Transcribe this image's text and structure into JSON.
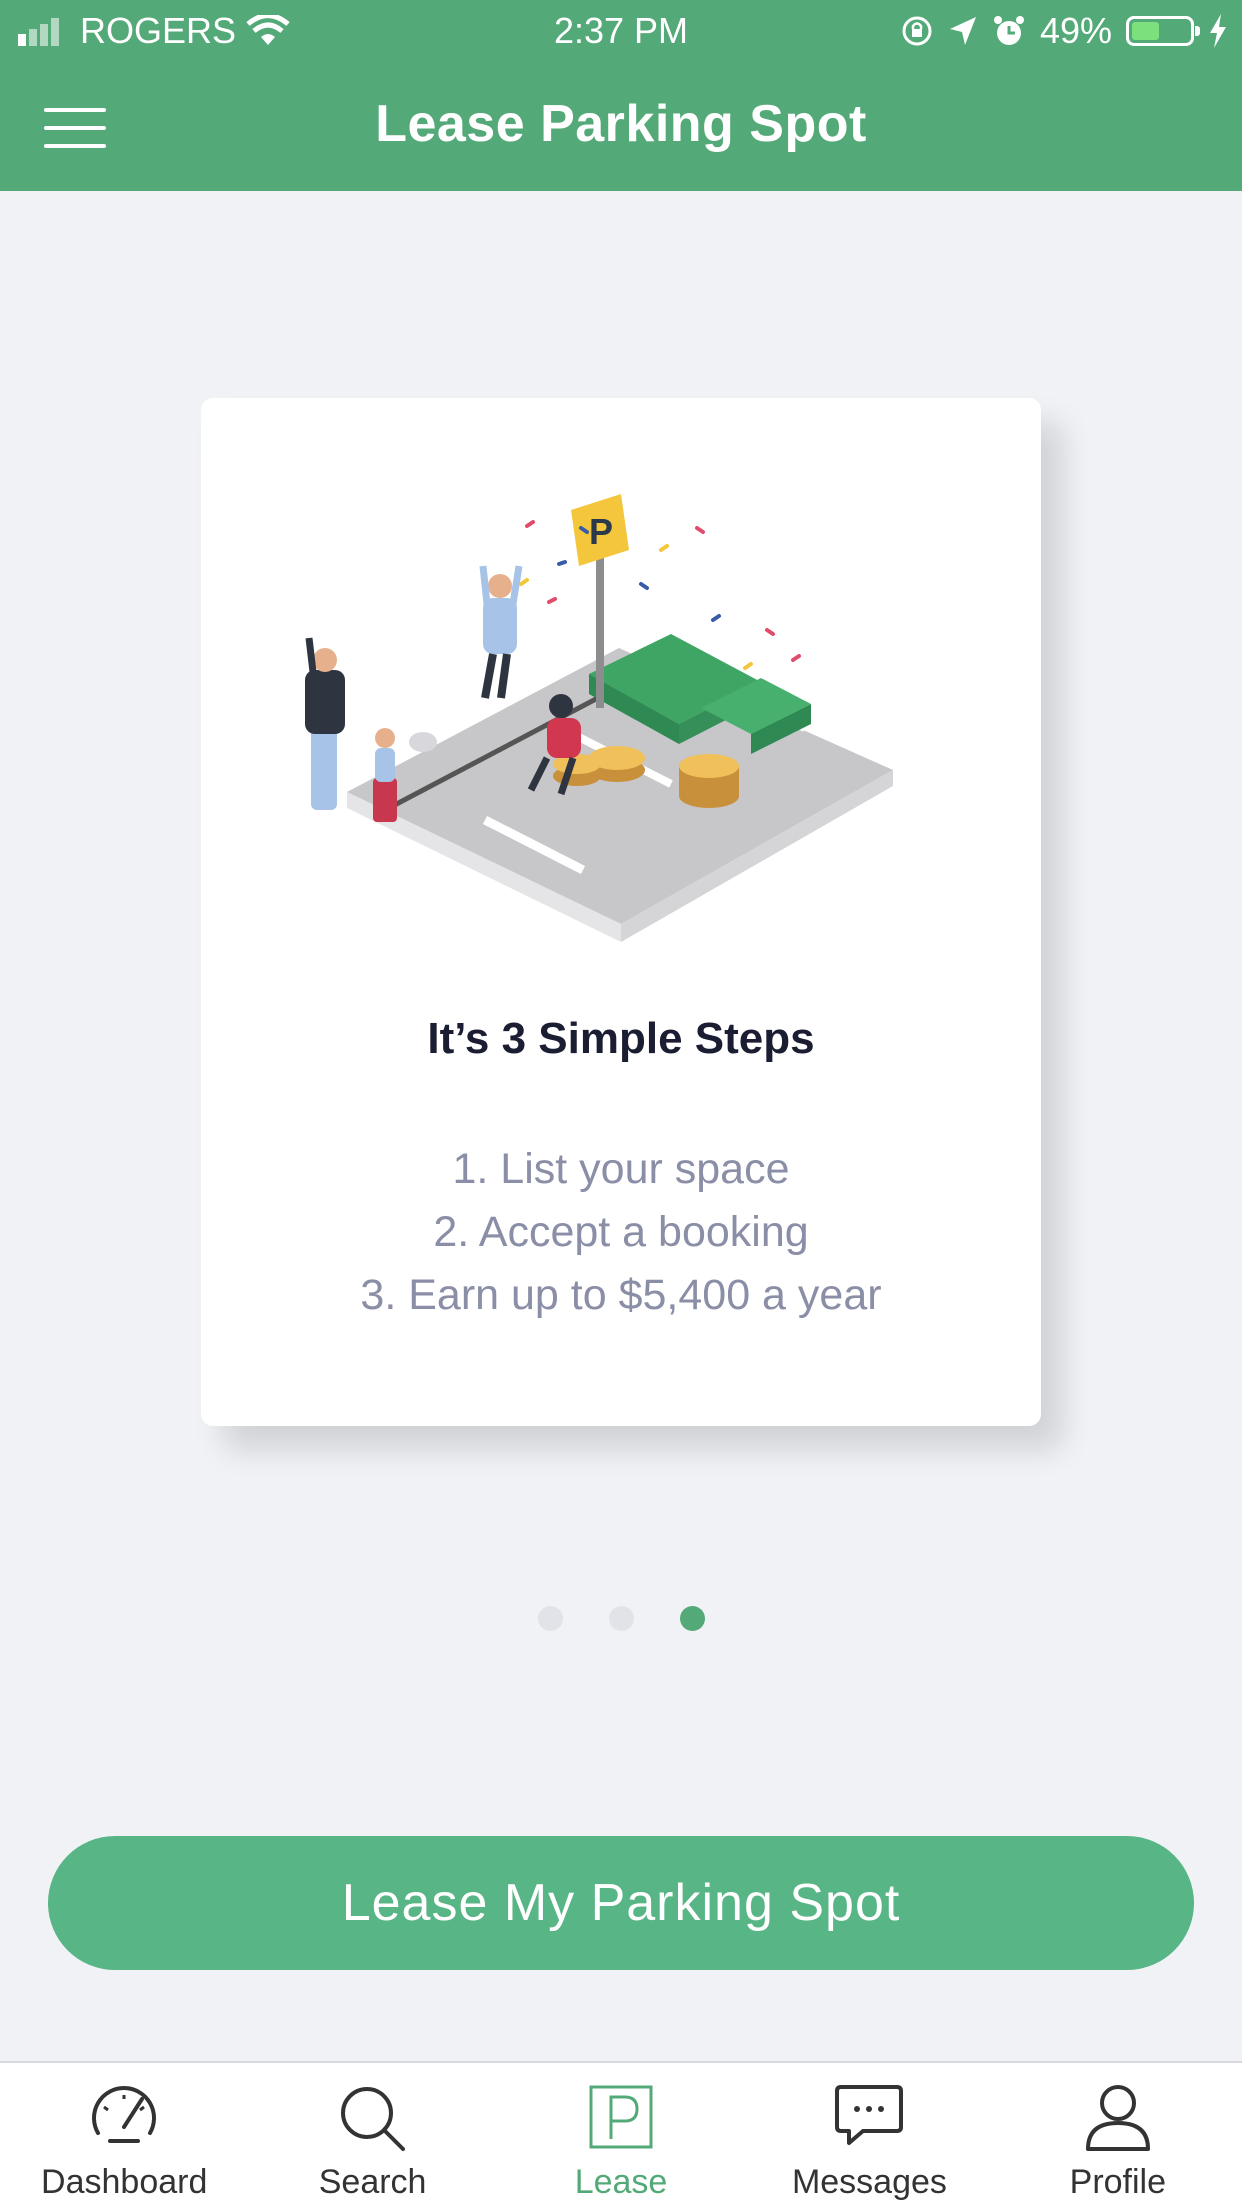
{
  "status_bar": {
    "carrier": "ROGERS",
    "time": "2:37 PM",
    "battery": "49%",
    "battery_level": 0.49
  },
  "header": {
    "title": "Lease Parking Spot"
  },
  "card": {
    "heading": "It’s 3 Simple Steps",
    "steps": [
      "1. List your space",
      "2. Accept a booking",
      "3. Earn up to $5,400 a year"
    ]
  },
  "carousel": {
    "page_count": 3,
    "active_index": 2
  },
  "cta": {
    "label": "Lease My Parking Spot"
  },
  "tabs": [
    {
      "label": "Dashboard",
      "icon": "dashboard-icon",
      "active": false
    },
    {
      "label": "Search",
      "icon": "search-icon",
      "active": false
    },
    {
      "label": "Lease",
      "icon": "parking-icon",
      "active": true
    },
    {
      "label": "Messages",
      "icon": "messages-icon",
      "active": false
    },
    {
      "label": "Profile",
      "icon": "profile-icon",
      "active": false
    }
  ],
  "colors": {
    "brand_green": "#54a978",
    "button_green": "#58b585",
    "background": "#f1f2f6"
  }
}
